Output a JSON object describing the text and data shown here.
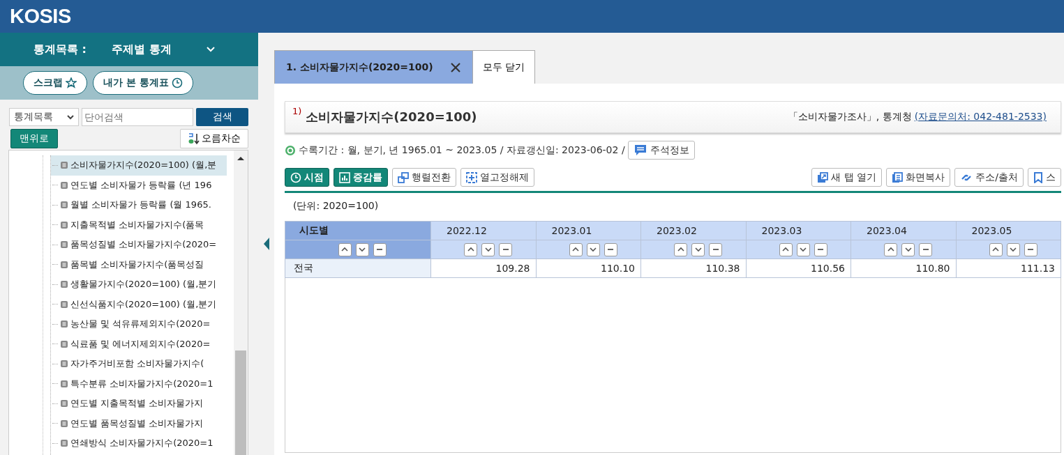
{
  "header": {
    "logo": "KOSIS"
  },
  "sidebar": {
    "catalog_label": "통계목록 :",
    "catalog_value": "주제별 통계",
    "buttons": [
      {
        "label": "스크랩",
        "kind": "star"
      },
      {
        "label": "내가 본 통계표",
        "kind": "clock"
      }
    ],
    "search": {
      "scope": "통계목록",
      "placeholder": "단어검색",
      "button": "검색"
    },
    "top_button": "맨위로",
    "sort_button": "오름차순",
    "tree": [
      {
        "label": "소비자물가지수(2020=100) (월,분",
        "selected": true
      },
      {
        "label": "연도별 소비자물가 등락률 (년 196",
        "selected": false
      },
      {
        "label": "월별 소비자물가 등락률 (월 1965.",
        "selected": false
      },
      {
        "label": "지출목적별 소비자물가지수(품목",
        "selected": false
      },
      {
        "label": "품목성질별 소비자물가지수(2020=",
        "selected": false
      },
      {
        "label": "품목별 소비자물가지수(품목성질",
        "selected": false
      },
      {
        "label": "생활물가지수(2020=100) (월,분기",
        "selected": false
      },
      {
        "label": "신선식품지수(2020=100) (월,분기",
        "selected": false
      },
      {
        "label": "농산물 및 석유류제외지수(2020=",
        "selected": false
      },
      {
        "label": "식료품 및 에너지제외지수(2020=",
        "selected": false
      },
      {
        "label": "자가주거비포함 소비자물가지수(",
        "selected": false
      },
      {
        "label": "특수분류 소비자물가지수(2020=1",
        "selected": false
      },
      {
        "label": "연도별 지출목적별 소비자물가지",
        "selected": false
      },
      {
        "label": "연도별 품목성질별 소비자물가지",
        "selected": false
      },
      {
        "label": "연쇄방식 소비자물가지수(2020=1",
        "selected": false
      }
    ]
  },
  "tabs": [
    {
      "label": "1. 소비자물가지수(2020=100)",
      "selected": true
    }
  ],
  "close_all": "모두 닫기",
  "title": {
    "note": "1)",
    "text": "소비자물가지수(2020=100)",
    "source": "「소비자물가조사」, 통계청",
    "contact": "(자료문의처: 042-481-2533)"
  },
  "info": {
    "text": "수록기간 : 월, 분기, 년 1965.01 ~ 2023.05 / 자료갱신일: 2023-06-02 /",
    "button": "주석정보"
  },
  "toolbar_left": [
    {
      "label": "시점",
      "kind": "clock",
      "primary": true
    },
    {
      "label": "증감률",
      "kind": "chart",
      "primary": true
    },
    {
      "label": "행렬전환",
      "kind": "swap",
      "primary": false
    },
    {
      "label": "열고정해제",
      "kind": "unlock",
      "primary": false
    }
  ],
  "toolbar_right": [
    {
      "label": "새 탭 열기",
      "kind": "newtab"
    },
    {
      "label": "화면복사",
      "kind": "copy"
    },
    {
      "label": "주소/출처",
      "kind": "link"
    },
    {
      "label": "스",
      "kind": "bookmark"
    }
  ],
  "unit": "(단위: 2020=100)",
  "table": {
    "row_header": "시도별",
    "columns": [
      "2022.12",
      "2023.01",
      "2023.02",
      "2023.03",
      "2023.04",
      "2023.05"
    ],
    "rows": [
      {
        "label": "전국",
        "values": [
          "109.28",
          "110.10",
          "110.38",
          "110.56",
          "110.80",
          "111.13"
        ]
      }
    ]
  }
}
